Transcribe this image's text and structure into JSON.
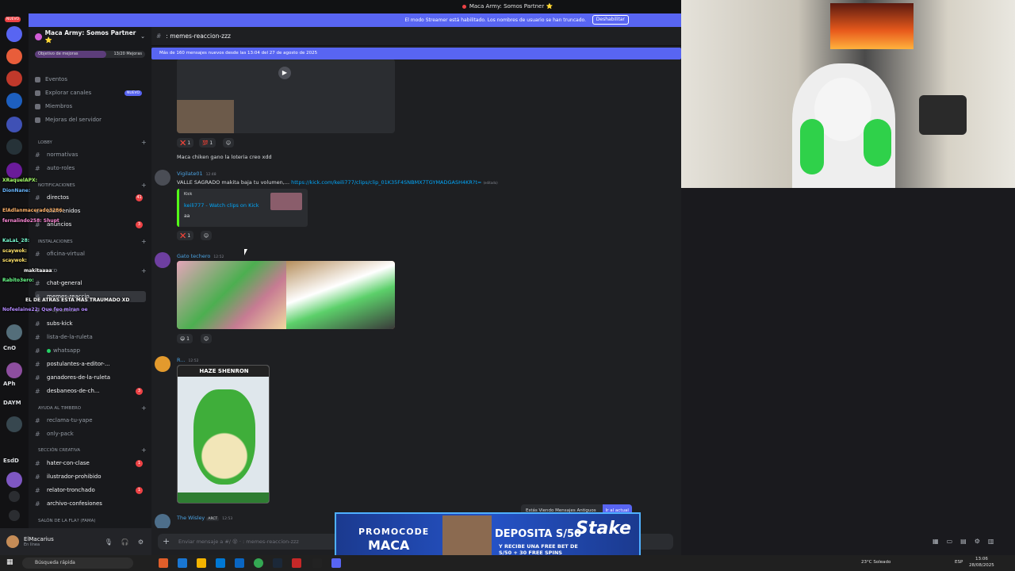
{
  "window": {
    "title": "Maca Army: Somos Partner ⭐"
  },
  "streamer_bar": {
    "message": "El modo Streamer está habilitado. Los nombres de usuario se han truncado.",
    "button": "Deshabilitar"
  },
  "server": {
    "name": "Maca Army: Somos Partner ⭐",
    "boost_goal": "Objetivo de mejoras",
    "boost_count": "13/20 Mejoras",
    "boost_fraction": 0.65
  },
  "sidebar": {
    "top_items": [
      {
        "label": "Eventos"
      },
      {
        "label": "Explorar canales",
        "badge": "NUEVO"
      },
      {
        "label": "Miembros"
      },
      {
        "label": "Mejoras del servidor"
      }
    ],
    "categories": {
      "lobby": "LOBBY",
      "notificaciones": "NOTIFICACIONES",
      "instalaciones": "INSTALACIONES",
      "publico": "PÚBLICO",
      "ayuda": "AYUDA AL TIMBERO",
      "creativa": "SECCIÓN CREATIVA",
      "salon": "SALÓN DE LA FLA? (FAMA)"
    },
    "channels": {
      "normativas": "normativas",
      "auto_roles": "auto-roles",
      "directos": "directos",
      "directos_cnt": "41",
      "bienvenidos": "bienvenidos",
      "anuncios": "anuncios",
      "anuncios_cnt": "3",
      "oficina_virtual": "oficina-virtual",
      "chat_general": "chat-general",
      "memes_reaccion": "memes-reaccio...",
      "apuestas": "e-apuestas",
      "subs_kick": "subs-kick",
      "lista_ruleta": "lista-de-la-ruleta",
      "whatsapp": "whatsapp",
      "postulantes": "postulantes-a-editor-...",
      "ganadores": "ganadores-de-la-ruleta",
      "desbaneos": "desbaneos-de-ch...",
      "desbaneos_cnt": "3",
      "reclama": "reclama-tu-yape",
      "only_pack": "only-pack",
      "hater": "hater-con-clase",
      "hater_cnt": "1",
      "ilustrador": "ilustrador-prohibido",
      "relator": "relator-tronchado",
      "relator_cnt": "1",
      "confesiones": "archivo-confesiones"
    }
  },
  "overlay_chat": [
    "XRaquelAPX:",
    "DionNane:",
    "ElAdlanmacerado3286:",
    "fernalindo258: Shupt",
    "KaLaL_28:",
    "scaywok:",
    "scaywok:",
    "makitaaaa",
    "Rabito3ero:",
    "EL DE ATRAS ESTA MAS TRAUMADO XD",
    "Nofeelaine22: Que feo miran oe"
  ],
  "user": {
    "name": "ElMacarius",
    "status": "En línea"
  },
  "channel_header": {
    "name": ": memes-reaccion-zzz"
  },
  "new_messages_bar": "Más de 160 mensajes nuevos desde las 13:04 del 27 de agosto de 2025",
  "messages": [
    {
      "text": "Maca chiken gano la loteria creo xdd",
      "reactions": [
        "❌ 1",
        "💯 1"
      ]
    },
    {
      "author": "Vigilate01",
      "time": "12:48",
      "text": "VALLE SAGRADO makita baja tu volumen,...",
      "link": "https://kick.com/keili777/clips/clip_01K35F4SNBMX7TGYMADGASH4KR?t=",
      "link_suffix": "(editado)",
      "embed": {
        "provider": "Kick",
        "title": "keili777 - Watch clips on Kick",
        "desc": "aa"
      },
      "reactions": [
        "❌ 1"
      ]
    },
    {
      "author": "Gato techero",
      "time": "12:52",
      "reactions": [
        "😄 1"
      ]
    },
    {
      "author": "R...",
      "time": "12:52",
      "image_caption": "HAZE SHENRON"
    },
    {
      "author": "The Wisley",
      "tag": "ARCT",
      "time": "12:53"
    }
  ],
  "jump_bar": {
    "text": "Estás Viendo Mensajes Antiguos",
    "button": "Ir al actual"
  },
  "composer": {
    "placeholder": "Enviar mensaje a #/ 😵 · : memes-reaccion-zzz"
  },
  "ad": {
    "promo": "PROMOCODE",
    "code": "MACA",
    "deposit": "DEPOSITA S/50",
    "bonus": "Y RECIBE UNA FREE BET DE S/50 + 30 FREE SPINS",
    "brand": "Stake"
  },
  "taskbar": {
    "search": "Búsqueda rápida",
    "weather": "23°C Soleado",
    "lang": "ESP",
    "time": "13:06",
    "date": "28/08/2025"
  },
  "rail": {
    "nuevo": "NUEVO",
    "labels": [
      "APh",
      "DAYM",
      "EsdD",
      "CnO"
    ]
  }
}
